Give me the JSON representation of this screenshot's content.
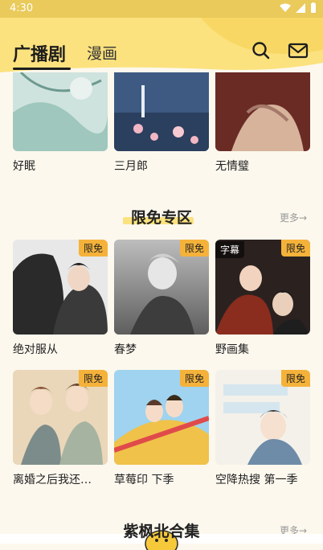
{
  "status": {
    "time": "4:30"
  },
  "header": {
    "tab_active": "广播剧",
    "tab_other": "漫画",
    "search_icon": "search-icon",
    "mail_icon": "mail-icon",
    "accent": "#fbe27e"
  },
  "row_top": [
    {
      "title": "好眠"
    },
    {
      "title": "三月郎"
    },
    {
      "title": "无情璧"
    }
  ],
  "section_free": {
    "title": "限免专区",
    "more": "更多→",
    "items": [
      {
        "title": "绝对服从",
        "badge": "限免",
        "tag": ""
      },
      {
        "title": "春梦",
        "badge": "限免",
        "tag": ""
      },
      {
        "title": "野画集",
        "badge": "限免",
        "tag": "字幕"
      },
      {
        "title": "离婚之后我还…",
        "badge": "限免",
        "tag": ""
      },
      {
        "title": "草莓印 下季",
        "badge": "限免",
        "tag": ""
      },
      {
        "title": "空降热搜 第一季",
        "badge": "限免",
        "tag": ""
      }
    ]
  },
  "section_next": {
    "title": "紫枫北合集",
    "more": "更多→"
  }
}
